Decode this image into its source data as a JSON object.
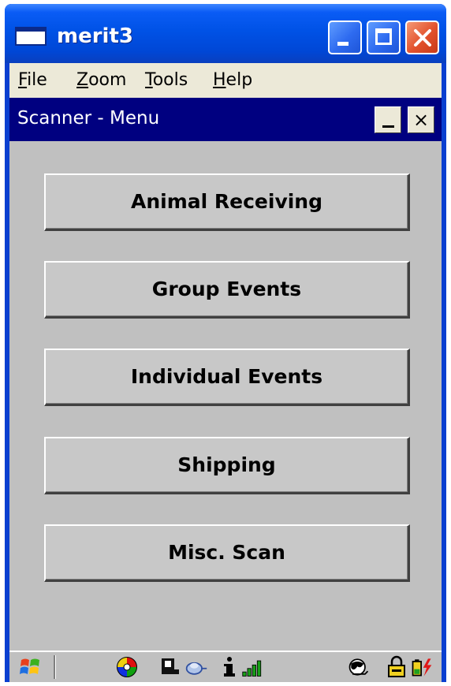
{
  "window": {
    "title": "merit3"
  },
  "menubar": {
    "items": [
      {
        "label_first": "F",
        "label_rest": "ile"
      },
      {
        "label_first": "Z",
        "label_rest": "oom"
      },
      {
        "label_first": "T",
        "label_rest": "ools"
      },
      {
        "label_first": "H",
        "label_rest": "elp"
      }
    ]
  },
  "inner_window": {
    "title": "Scanner - Menu",
    "close_glyph": "×"
  },
  "menu_buttons": [
    {
      "label": "Animal Receiving"
    },
    {
      "label": "Group Events"
    },
    {
      "label": "Individual Events"
    },
    {
      "label": "Shipping"
    },
    {
      "label": "Misc. Scan"
    }
  ],
  "taskbar": {
    "icons": [
      "start-windows-icon",
      "color-wheel-icon",
      "card-icon",
      "mouse-icon",
      "info-icon",
      "signal-strength-icon",
      "network-icon",
      "lock-icon",
      "battery-icon"
    ]
  },
  "colors": {
    "xp_title_blue": "#0052e6",
    "close_red": "#e2512c",
    "inner_title_navy": "#000080",
    "client_gray": "#c0c0c0",
    "menubar_beige": "#ece9d8"
  }
}
